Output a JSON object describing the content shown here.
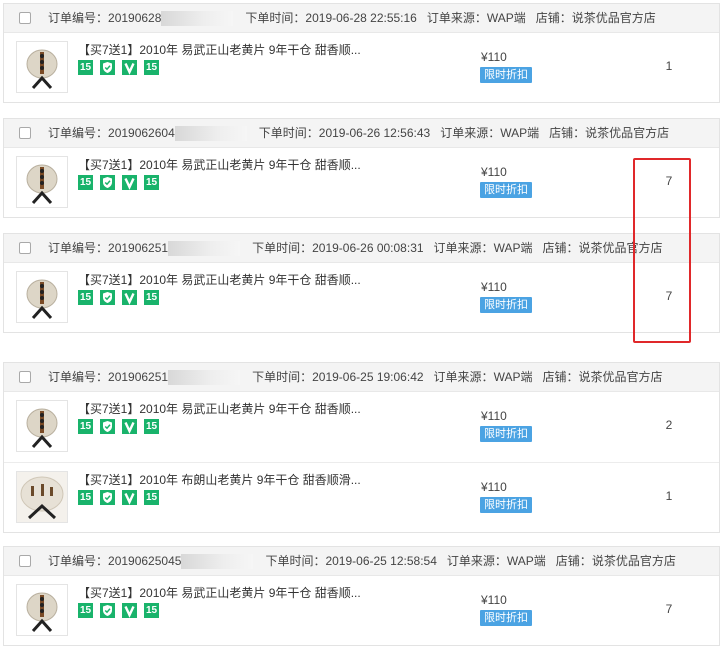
{
  "labels": {
    "order_no": "订单编号：",
    "order_time": "下单时间：",
    "order_source": "订单来源：",
    "shop": "店铺："
  },
  "orders": [
    {
      "no_prefix": "20190628",
      "time": "2019-06-28 22:55:16",
      "source": "WAP端",
      "shop": "说茶优品官方店",
      "items": [
        {
          "title": "【买7送1】2010年 易武正山老黄片 9年干仓 甜香顺...",
          "price": "¥110",
          "promo": "限时折扣",
          "qty": "1",
          "thumb": "cake-dark"
        }
      ]
    },
    {
      "no_prefix": "20190626​04",
      "time": "2019-06-26 12:56:43",
      "source": "WAP端",
      "shop": "说茶优品官方店",
      "items": [
        {
          "title": "【买7送1】2010年 易武正山老黄片 9年干仓 甜香顺...",
          "price": "¥110",
          "promo": "限时折扣",
          "qty": "7",
          "thumb": "cake-dark"
        }
      ]
    },
    {
      "no_prefix": "20190625​1",
      "time": "2019-06-26 00:08:31",
      "source": "WAP端",
      "shop": "说茶优品官方店",
      "items": [
        {
          "title": "【买7送1】2010年 易武正山老黄片 9年干仓 甜香顺...",
          "price": "¥110",
          "promo": "限时折扣",
          "qty": "7",
          "thumb": "cake-dark"
        }
      ]
    },
    {
      "no_prefix": "20190625​1",
      "time": "2019-06-25 19:06:42",
      "source": "WAP端",
      "shop": "说茶优品官方店",
      "items": [
        {
          "title": "【买7送1】2010年 易武正山老黄片 9年干仓 甜香顺...",
          "price": "¥110",
          "promo": "限时折扣",
          "qty": "2",
          "thumb": "cake-dark"
        },
        {
          "title": "【买7送1】2010年 布朗山老黄片 9年干仓 甜香顺滑...",
          "price": "¥110",
          "promo": "限时折扣",
          "qty": "1",
          "thumb": "cake-light"
        }
      ]
    },
    {
      "no_prefix": "2019062504​5",
      "time": "2019-06-25 12:58:54",
      "source": "WAP端",
      "shop": "说茶优品官方店",
      "items": [
        {
          "title": "【买7送1】2010年 易武正山老黄片 9年干仓 甜香顺...",
          "price": "¥110",
          "promo": "限时折扣",
          "qty": "7",
          "thumb": "cake-dark"
        }
      ]
    }
  ],
  "badges": [
    {
      "text": "15",
      "icon": "number-badge"
    },
    {
      "text": "",
      "icon": "shield-check-icon"
    },
    {
      "text": "",
      "icon": "v-icon"
    },
    {
      "text": "15",
      "icon": "number-badge"
    }
  ],
  "colors": {
    "badge_green": "#19b36b",
    "promo_blue": "#4ba3e3",
    "highlight_red": "#e0282a",
    "header_bg": "#f4f4f4"
  }
}
